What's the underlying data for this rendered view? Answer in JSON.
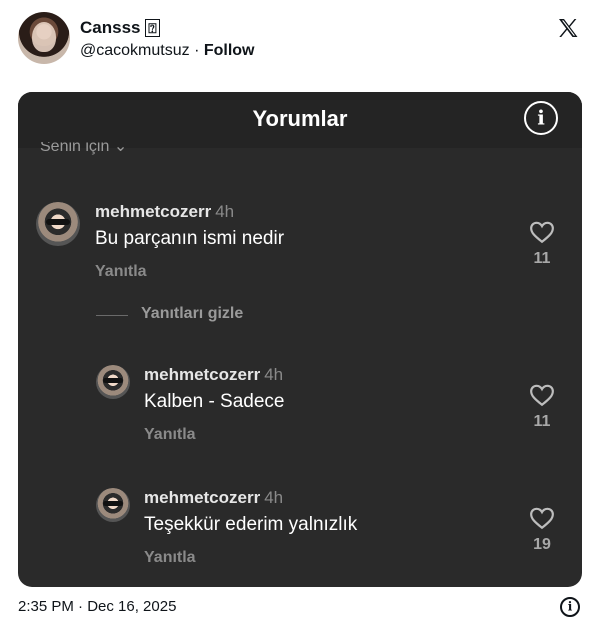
{
  "tweet": {
    "display_name": "Cansss",
    "name_emoji": "⍰",
    "handle": "@cacokmutsuz",
    "separator": "·",
    "follow_label": "Follow",
    "timestamp": "2:35 PM · Dec 16, 2025"
  },
  "screenshot": {
    "title": "Yorumlar",
    "sort_label": "Senin için",
    "comments": [
      {
        "user": "mehmetcozerr",
        "time": "4h",
        "text": "Bu parçanın ismi nedir",
        "reply_label": "Yanıtla",
        "likes": "11"
      },
      {
        "user": "mehmetcozerr",
        "time": "4h",
        "text": "Kalben - Sadece",
        "reply_label": "Yanıtla",
        "likes": "11"
      },
      {
        "user": "mehmetcozerr",
        "time": "4h",
        "text": "Teşekkür ederim yalnızlık",
        "reply_label": "Yanıtla",
        "likes": "19"
      }
    ],
    "hide_replies_label": "Yanıtları gizle"
  },
  "icons": {
    "logo": "x-logo-icon",
    "info": "info-icon",
    "heart": "heart-outline-icon",
    "chevron": "chevron-down-icon"
  },
  "colors": {
    "card_bg": "#2a2a2a",
    "text_primary": "#0f1419",
    "muted": "#8a8a8a"
  }
}
